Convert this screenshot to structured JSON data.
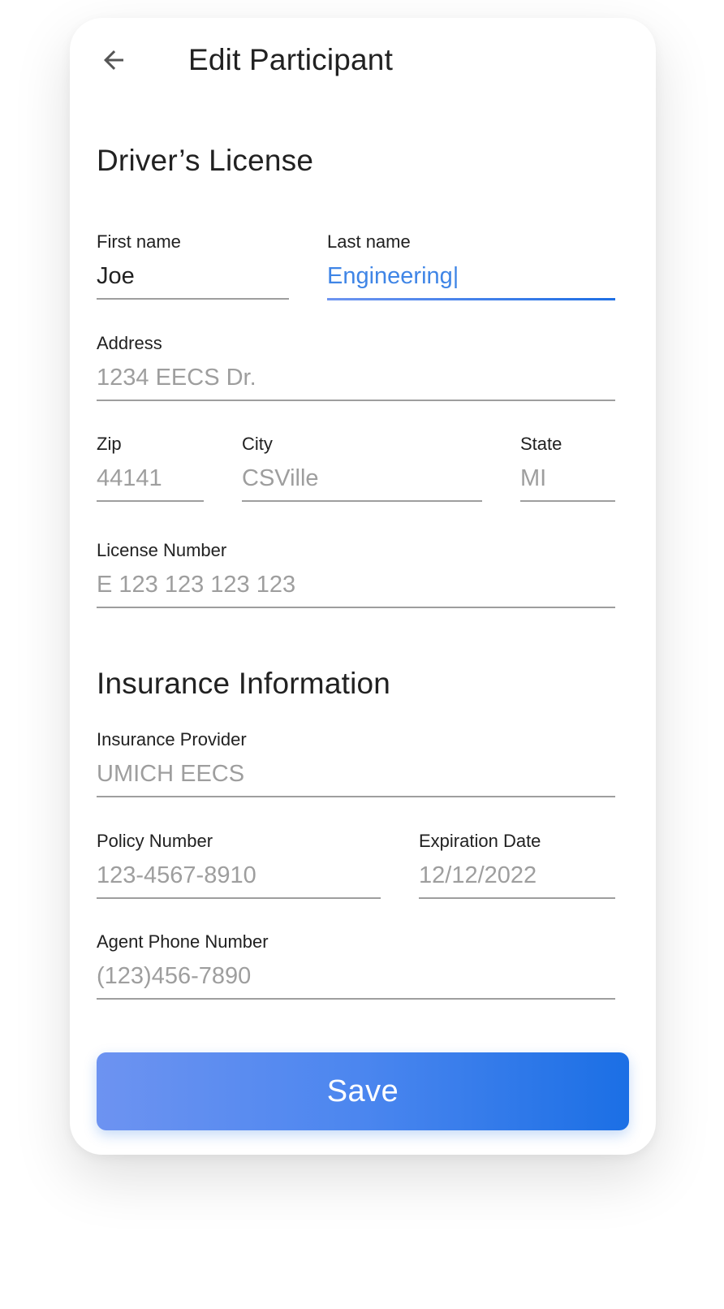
{
  "header": {
    "title": "Edit Participant",
    "back_icon": "arrow-left-icon"
  },
  "drivers_license": {
    "title": "Driver’s License",
    "first_name": {
      "label": "First name",
      "value": "Joe",
      "placeholder": ""
    },
    "last_name": {
      "label": "Last name",
      "value": "Engineering|",
      "placeholder": ""
    },
    "address": {
      "label": "Address",
      "placeholder": "1234 EECS Dr."
    },
    "zip": {
      "label": "Zip",
      "placeholder": "44141"
    },
    "city": {
      "label": "City",
      "placeholder": "CSVille"
    },
    "state": {
      "label": "State",
      "placeholder": "MI"
    },
    "license_number": {
      "label": "License Number",
      "placeholder": "E 123 123 123 123"
    }
  },
  "insurance": {
    "title": "Insurance Information",
    "provider": {
      "label": "Insurance Provider",
      "placeholder": "UMICH EECS"
    },
    "policy_number": {
      "label": "Policy Number",
      "placeholder": "123-4567-8910"
    },
    "expiration_date": {
      "label": "Expiration Date",
      "placeholder": "12/12/2022"
    },
    "agent_phone": {
      "label": "Agent Phone Number",
      "placeholder": "(123)456-7890"
    }
  },
  "actions": {
    "save_label": "Save"
  },
  "colors": {
    "accent": "#3f85e6",
    "button_start": "#6d93f1",
    "button_end": "#1b6fe5",
    "text": "#212121",
    "placeholder": "#9e9e9e"
  }
}
